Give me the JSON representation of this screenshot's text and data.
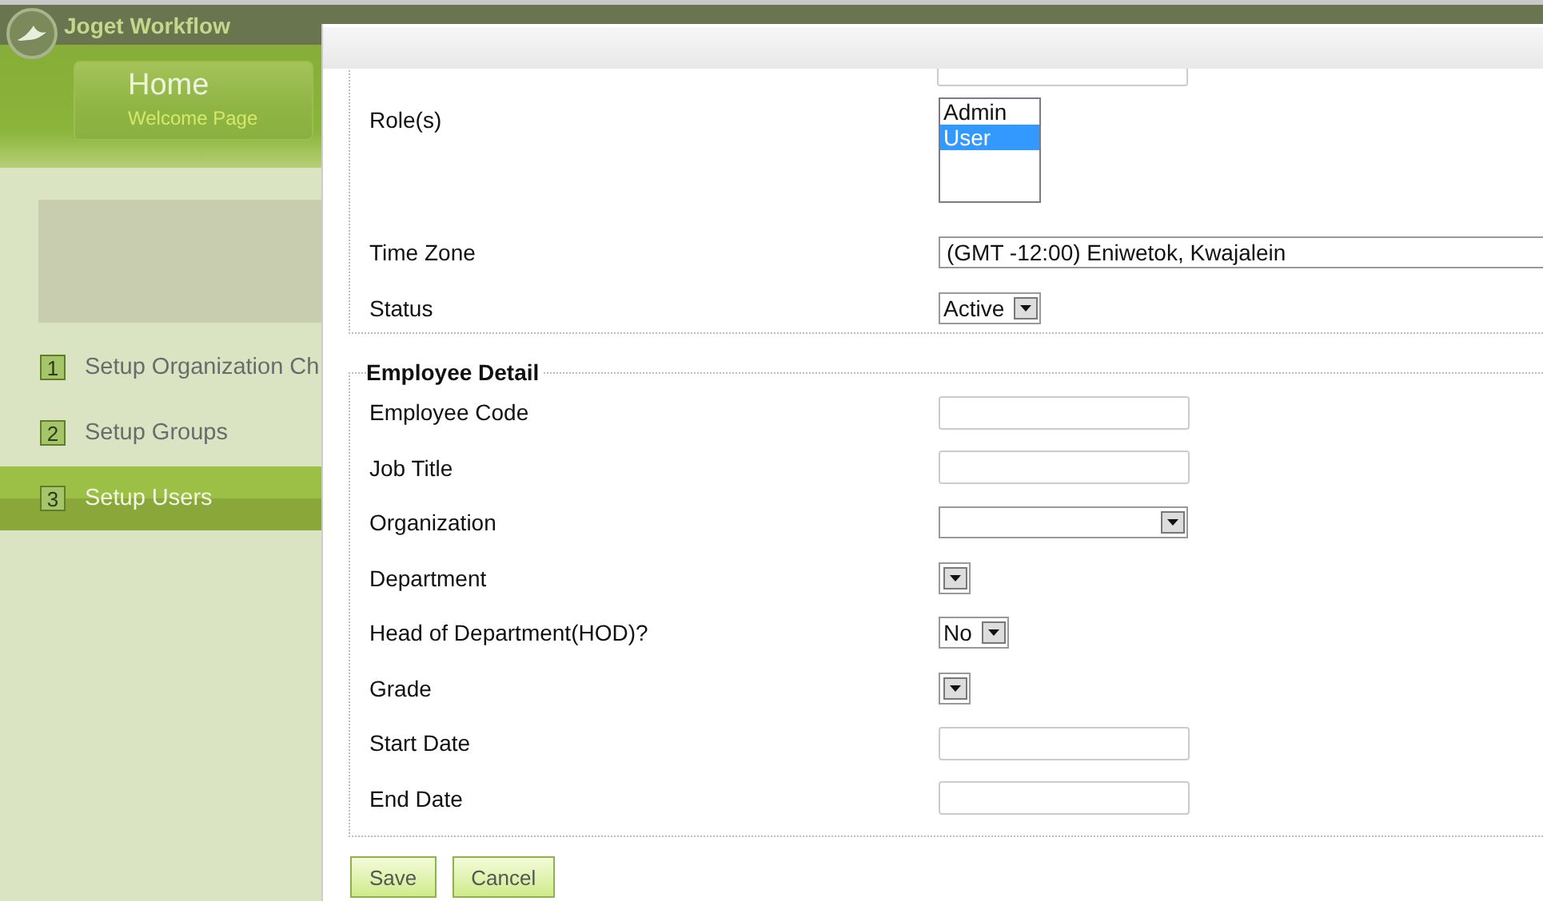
{
  "app": {
    "title": "Joget Workflow",
    "home_tab": {
      "title": "Home",
      "subtitle": "Welcome Page"
    },
    "steps": [
      {
        "number": "1",
        "label": "Setup Organization Ch",
        "selected": false
      },
      {
        "number": "2",
        "label": "Setup Groups",
        "selected": false
      },
      {
        "number": "3",
        "label": "Setup Users",
        "selected": true
      }
    ]
  },
  "dialog": {
    "account_fields": [
      {
        "kind": "listbox",
        "label": "Role(s)",
        "options": [
          {
            "label": "Admin",
            "selected": false
          },
          {
            "label": "User",
            "selected": true
          }
        ]
      },
      {
        "kind": "select-full",
        "label": "Time Zone",
        "value": "(GMT -12:00) Eniwetok, Kwajalein"
      },
      {
        "kind": "select",
        "label": "Status",
        "value": "Active"
      }
    ],
    "employee_detail": {
      "legend": "Employee Detail",
      "fields": [
        {
          "kind": "text",
          "label": "Employee Code"
        },
        {
          "kind": "text",
          "label": "Job Title"
        },
        {
          "kind": "select-wide",
          "label": "Organization"
        },
        {
          "kind": "select",
          "label": "Department"
        },
        {
          "kind": "select",
          "label": "Head of Department(HOD)?",
          "value": "No"
        },
        {
          "kind": "select",
          "label": "Grade"
        },
        {
          "kind": "text",
          "label": "Start Date"
        },
        {
          "kind": "text",
          "label": "End Date"
        }
      ]
    },
    "buttons": [
      "Save",
      "Cancel"
    ]
  }
}
